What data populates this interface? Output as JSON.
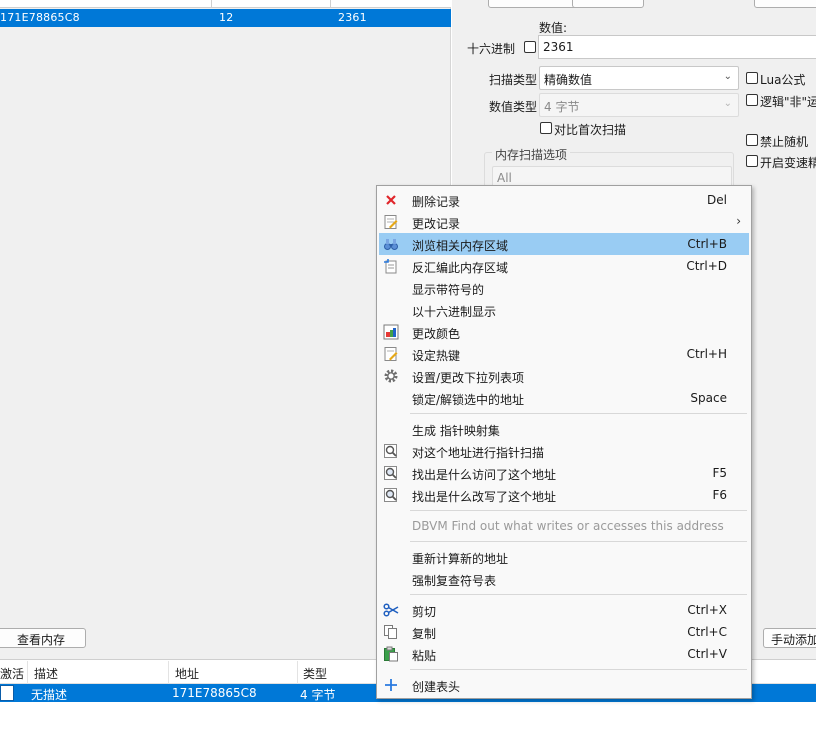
{
  "results": {
    "row": {
      "address": "171E78865C8",
      "value": "12",
      "previous": "2361"
    }
  },
  "scan": {
    "value_label": "数值:",
    "hex_label": "十六进制",
    "value": "2361",
    "scan_type_label": "扫描类型",
    "scan_type": "精确数值",
    "value_type_label": "数值类型",
    "value_type": "4 字节",
    "compare_first_label": "对比首次扫描",
    "lua_label": "Lua公式",
    "logic_not_label": "逻辑\"非\"运",
    "disable_random_label": "禁止随机",
    "enable_speedhack_label": "开启变速精",
    "mem_options_title": "内存扫描选项",
    "mem_region": "All"
  },
  "bottom": {
    "view_memory_button": "查看内存",
    "add_manual_button": "手动添加"
  },
  "address_list": {
    "headers": {
      "active": "激活",
      "description": "描述",
      "address": "地址",
      "type": "类型"
    },
    "row": {
      "description": "无描述",
      "address": "171E78865C8",
      "type": "4 字节"
    }
  },
  "context_menu": {
    "items": [
      {
        "label": "删除记录",
        "shortcut": "Del",
        "icon": "delete-x-icon"
      },
      {
        "label": "更改记录",
        "shortcut": "",
        "icon": "edit-record-icon",
        "submenu": true
      },
      {
        "label": "浏览相关内存区域",
        "shortcut": "Ctrl+B",
        "icon": "binoculars-icon",
        "highlighted": true
      },
      {
        "label": "反汇编此内存区域",
        "shortcut": "Ctrl+D",
        "icon": "disassemble-icon"
      },
      {
        "label": "显示带符号的",
        "shortcut": ""
      },
      {
        "label": "以十六进制显示",
        "shortcut": ""
      },
      {
        "label": "更改颜色",
        "shortcut": "",
        "icon": "color-icon"
      },
      {
        "label": "设定热键",
        "shortcut": "Ctrl+H",
        "icon": "hotkey-icon"
      },
      {
        "label": "设置/更改下拉列表项",
        "shortcut": "",
        "icon": "gear-icon"
      },
      {
        "label": "锁定/解锁选中的地址",
        "shortcut": "Space"
      },
      {
        "label": "生成 指针映射集",
        "shortcut": ""
      },
      {
        "label": "对这个地址进行指针扫描",
        "shortcut": "",
        "icon": "pointer-scan-icon"
      },
      {
        "label": "找出是什么访问了这个地址",
        "shortcut": "F5",
        "icon": "find-access-icon"
      },
      {
        "label": "找出是什么改写了这个地址",
        "shortcut": "F6",
        "icon": "find-write-icon"
      },
      {
        "label": "DBVM Find out what writes or accesses this address",
        "shortcut": "",
        "disabled": true
      },
      {
        "label": "重新计算新的地址",
        "shortcut": ""
      },
      {
        "label": "强制复查符号表",
        "shortcut": ""
      },
      {
        "label": "剪切",
        "shortcut": "Ctrl+X",
        "icon": "scissors-icon"
      },
      {
        "label": "复制",
        "shortcut": "Ctrl+C",
        "icon": "copy-icon"
      },
      {
        "label": "粘贴",
        "shortcut": "Ctrl+V",
        "icon": "paste-icon"
      },
      {
        "label": "创建表头",
        "shortcut": "",
        "icon": "plus-icon"
      }
    ]
  },
  "colors": {
    "selection": "#0078d7",
    "menu_highlight": "#99ccf3",
    "window_bg": "#f0f0f0"
  }
}
